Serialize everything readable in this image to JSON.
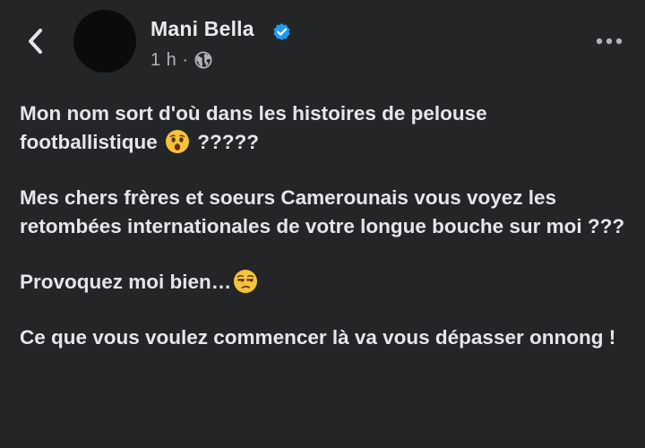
{
  "post": {
    "author_name": "Mani Bella",
    "timestamp": "1 h",
    "meta_separator": "·",
    "visibility_icon": "globe-icon",
    "verified_icon": "verified-badge-icon",
    "paragraphs": [
      {
        "line1": "Mon nom sort d'où dans les histoires de pelouse",
        "line2_before": "footballistique",
        "emoji": "hushed-face-emoji",
        "line2_after": "?????"
      },
      {
        "text": "Mes chers frères et soeurs Camerounais vous voyez les retombées internationales de votre longue bouche sur moi ???"
      },
      {
        "before": "Provoquez moi bien…",
        "emoji": "unamused-face-emoji"
      },
      {
        "text": "Ce que vous voulez commencer là va vous dépasser onnong !"
      }
    ]
  },
  "colors": {
    "background": "#242526",
    "text_primary": "#e4e6eb",
    "text_secondary": "#b0b3b8",
    "verified_blue": "#1d9bf0",
    "emoji_yellow": "#f5c33b"
  }
}
